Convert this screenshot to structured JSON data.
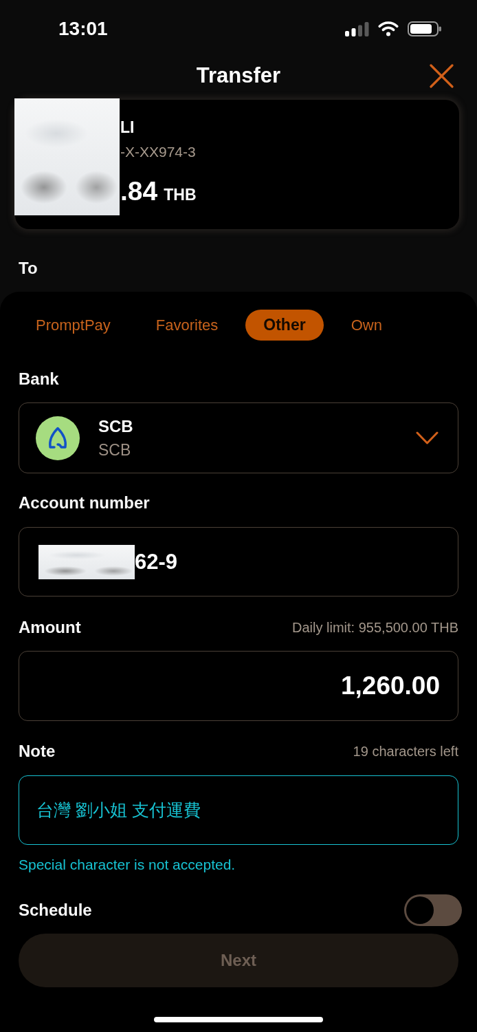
{
  "status_bar": {
    "time": "13:01"
  },
  "header": {
    "title": "Transfer"
  },
  "from_account": {
    "name": "LI",
    "number": "-X-XX974-3",
    "balance": ".84",
    "currency": "THB"
  },
  "to_label": "To",
  "tabs": [
    {
      "label": "PromptPay",
      "selected": false
    },
    {
      "label": "Favorites",
      "selected": false
    },
    {
      "label": "Other",
      "selected": true
    },
    {
      "label": "Own",
      "selected": false
    }
  ],
  "bank": {
    "label": "Bank",
    "name": "SCB",
    "code": "SCB"
  },
  "account_number": {
    "label": "Account number",
    "value": "62-9"
  },
  "amount": {
    "label": "Amount",
    "daily_limit": "Daily limit: 955,500.00 THB",
    "value": "1,260.00"
  },
  "note": {
    "label": "Note",
    "counter": "19 characters left",
    "value": "台灣 劉小姐 支付運費",
    "focused": true,
    "error": "Special character is not accepted."
  },
  "schedule": {
    "label": "Schedule",
    "on": false
  },
  "next_button": {
    "label": "Next",
    "disabled": true
  }
}
